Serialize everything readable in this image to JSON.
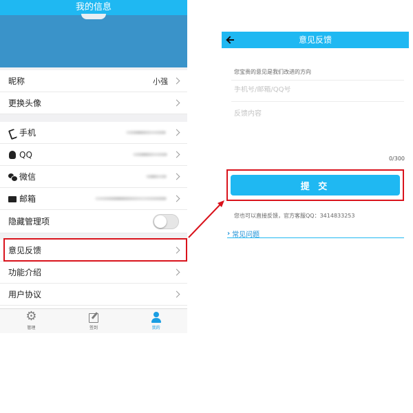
{
  "profile": {
    "title": "我的信息",
    "rows": [
      {
        "label": "昵称",
        "value": "小强"
      },
      {
        "label": "更换头像"
      },
      {
        "label": "手机"
      },
      {
        "label": "QQ"
      },
      {
        "label": "微信"
      },
      {
        "label": "邮箱"
      },
      {
        "label": "隐藏管理项"
      },
      {
        "label": "意见反馈"
      },
      {
        "label": "功能介绍"
      },
      {
        "label": "用户协议"
      }
    ],
    "tabs": [
      {
        "label": "管理",
        "icon": "gear-icon"
      },
      {
        "label": "签到",
        "icon": "edit-icon"
      },
      {
        "label": "我的",
        "icon": "user-icon"
      }
    ]
  },
  "feedback": {
    "title": "意见反馈",
    "hint": "您宝贵的意见是我们改进的方向",
    "contact_placeholder": "手机号/邮箱/QQ号",
    "content_placeholder": "反馈内容",
    "counter": "0/300",
    "submit_label": "提 交",
    "direct_text": "您也可以直接反馈，官方客服QQ：3414833253",
    "faq_label": "常见问题"
  },
  "colors": {
    "accent": "#1fb8f2",
    "banner": "#3a93c9",
    "highlight": "#d9121b",
    "active_tab": "#1a9ee3"
  }
}
